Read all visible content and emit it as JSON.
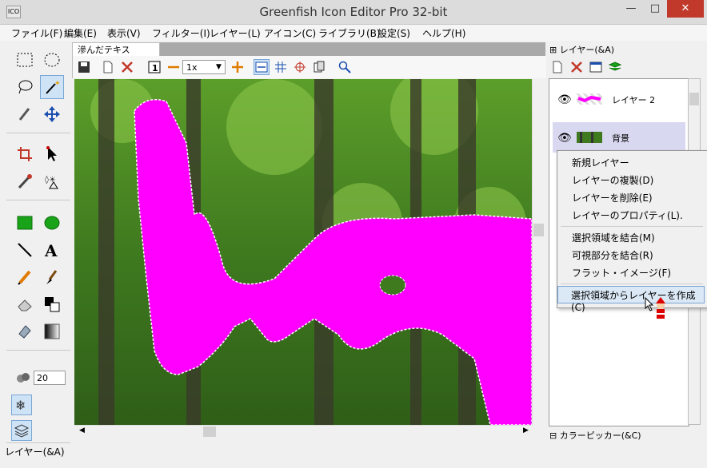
{
  "window": {
    "title": "Greenfish Icon Editor Pro 32-bit",
    "app_icon_text": "ICO",
    "minimize": "—",
    "maximize": "□",
    "close": "✕"
  },
  "menu": [
    "ファイル(F)",
    "編集(E)",
    "表示(V)",
    "フィルター(I)",
    "レイヤー(L)",
    "アイコン(C)",
    "ライブラリ(B)",
    "設定(S)",
    "ヘルプ(H)"
  ],
  "toolbox": {
    "brush_size": "20",
    "panel_label": "レイヤー(&A)"
  },
  "document": {
    "tab_label": "滲んだテキスト.png*",
    "zoom": "1x"
  },
  "layers_panel": {
    "header": "レイヤー(&A)",
    "expander": "⊞",
    "layers": [
      {
        "name": "レイヤー 2"
      },
      {
        "name": "背景"
      }
    ]
  },
  "context_menu": {
    "items": [
      "新規レイヤー",
      "レイヤーの複製(D)",
      "レイヤーを削除(E)",
      "レイヤーのプロパティ(L)."
    ],
    "items2": [
      "選択領域を結合(M)",
      "可視部分を結合(R)",
      "フラット・イメージ(F)"
    ],
    "items3": [
      "選択領域からレイヤーを作成(C)"
    ]
  },
  "color_picker": {
    "header": "カラーピッカー(&C)",
    "expander": "⊟"
  },
  "colors": {
    "magenta": "#ff00ff",
    "selection": "#cfe3f7"
  }
}
